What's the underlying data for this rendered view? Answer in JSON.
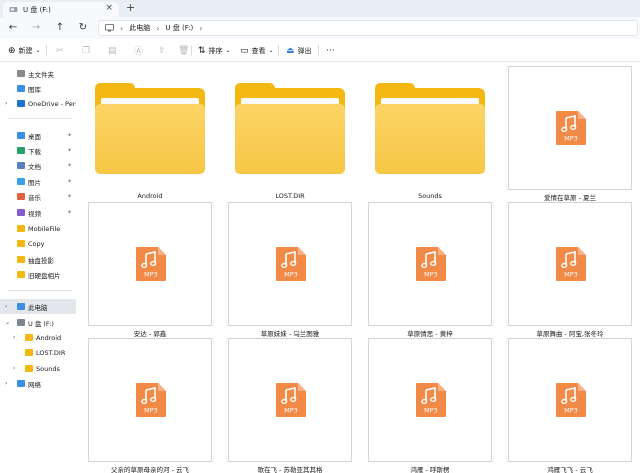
{
  "tab": {
    "title": "U 盘 (F:)"
  },
  "address": {
    "crumbs": [
      "此电脑",
      "U 盘 (F:)"
    ]
  },
  "toolbar": {
    "new_label": "新建",
    "sort_label": "排序",
    "view_label": "查看",
    "eject_label": "弹出",
    "more_label": "···"
  },
  "sidebar": {
    "items": [
      {
        "label": "主文件夹",
        "icon": "home-icon"
      },
      {
        "label": "图库",
        "icon": "gallery-icon"
      },
      {
        "label": "OneDrive - Perso",
        "icon": "cloud-icon"
      },
      {
        "label": "桌面",
        "icon": "desktop-icon"
      },
      {
        "label": "下载",
        "icon": "download-icon"
      },
      {
        "label": "文档",
        "icon": "document-icon"
      },
      {
        "label": "图片",
        "icon": "picture-icon"
      },
      {
        "label": "音乐",
        "icon": "music-icon"
      },
      {
        "label": "视频",
        "icon": "video-icon"
      },
      {
        "label": "MobileFile",
        "icon": "folder-icon"
      },
      {
        "label": "Copy",
        "icon": "folder-icon"
      },
      {
        "label": "抽盘投影",
        "icon": "folder-icon"
      },
      {
        "label": "旧硬盘相片",
        "icon": "folder-icon"
      },
      {
        "label": "此电脑",
        "icon": "computer-icon"
      },
      {
        "label": "U 盘 (F:)",
        "icon": "usb-drive-icon"
      },
      {
        "label": "Android",
        "icon": "folder-icon"
      },
      {
        "label": "LOST.DIR",
        "icon": "folder-icon"
      },
      {
        "label": "Sounds",
        "icon": "folder-icon"
      },
      {
        "label": "网络",
        "icon": "network-icon"
      }
    ]
  },
  "files": [
    {
      "name": "Android",
      "kind": "folder"
    },
    {
      "name": "LOST.DIR",
      "kind": "folder"
    },
    {
      "name": "Sounds",
      "kind": "folder"
    },
    {
      "name": "爱情在草原 - 夏兰",
      "kind": "mp3"
    },
    {
      "name": "安达 - 郭鑫",
      "kind": "mp3"
    },
    {
      "name": "草原妹妹 - 乌兰图雅",
      "kind": "mp3"
    },
    {
      "name": "草原情思 - 黄梓",
      "kind": "mp3"
    },
    {
      "name": "草原舞曲 - 阿宝,张冬玲",
      "kind": "mp3"
    },
    {
      "name": "父亲的草原母亲的河 - 云飞",
      "kind": "mp3"
    },
    {
      "name": "歌在飞 - 苏勒亚其其格",
      "kind": "mp3"
    },
    {
      "name": "鸿雁 - 呼斯楞",
      "kind": "mp3"
    },
    {
      "name": "鸿雁飞飞 - 云飞",
      "kind": "mp3"
    }
  ],
  "mp3_badge": "MP3",
  "colors": {
    "folder": "#f3b912",
    "mp3": "#f08a46",
    "selected": "#e3e6ea"
  }
}
